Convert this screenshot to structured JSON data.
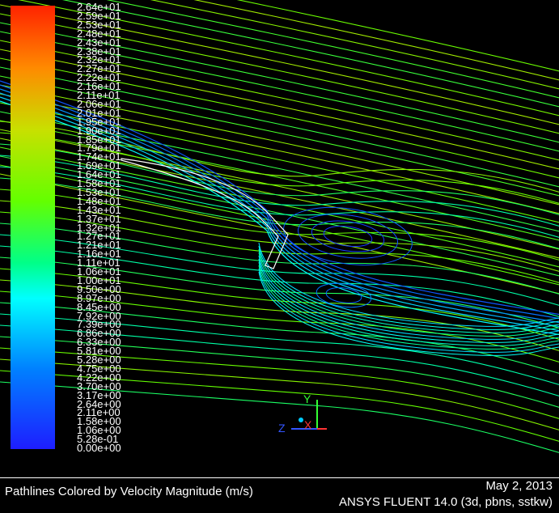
{
  "colorbar": {
    "ticks": [
      "2.64e+01",
      "2.59e+01",
      "2.53e+01",
      "2.48e+01",
      "2.43e+01",
      "2.38e+01",
      "2.32e+01",
      "2.27e+01",
      "2.22e+01",
      "2.16e+01",
      "2.11e+01",
      "2.06e+01",
      "2.01e+01",
      "1.95e+01",
      "1.90e+01",
      "1.85e+01",
      "1.79e+01",
      "1.74e+01",
      "1.69e+01",
      "1.64e+01",
      "1.58e+01",
      "1.53e+01",
      "1.48e+01",
      "1.43e+01",
      "1.37e+01",
      "1.32e+01",
      "1.27e+01",
      "1.21e+01",
      "1.16e+01",
      "1.11e+01",
      "1.06e+01",
      "1.00e+01",
      "9.50e+00",
      "8.97e+00",
      "8.45e+00",
      "7.92e+00",
      "7.39e+00",
      "6.86e+00",
      "6.33e+00",
      "5.81e+00",
      "5.28e+00",
      "4.75e+00",
      "4.22e+00",
      "3.70e+00",
      "3.17e+00",
      "2.64e+00",
      "2.11e+00",
      "1.58e+00",
      "1.06e+00",
      "5.28e-01",
      "0.00e+00"
    ],
    "max": 26.4,
    "min": 0.0,
    "colors": [
      "#1e1eff",
      "#0080ff",
      "#00ffff",
      "#00ff88",
      "#64ff00",
      "#c8e000",
      "#ff8a00",
      "#ff2200"
    ]
  },
  "axes": {
    "x": "X",
    "y": "Y",
    "z": "Z"
  },
  "footer": {
    "caption": "Pathlines Colored by Velocity Magnitude (m/s)",
    "date": "May 2, 2013",
    "solver": "ANSYS FLUENT 14.0 (3d, pbns, sstkw)"
  }
}
